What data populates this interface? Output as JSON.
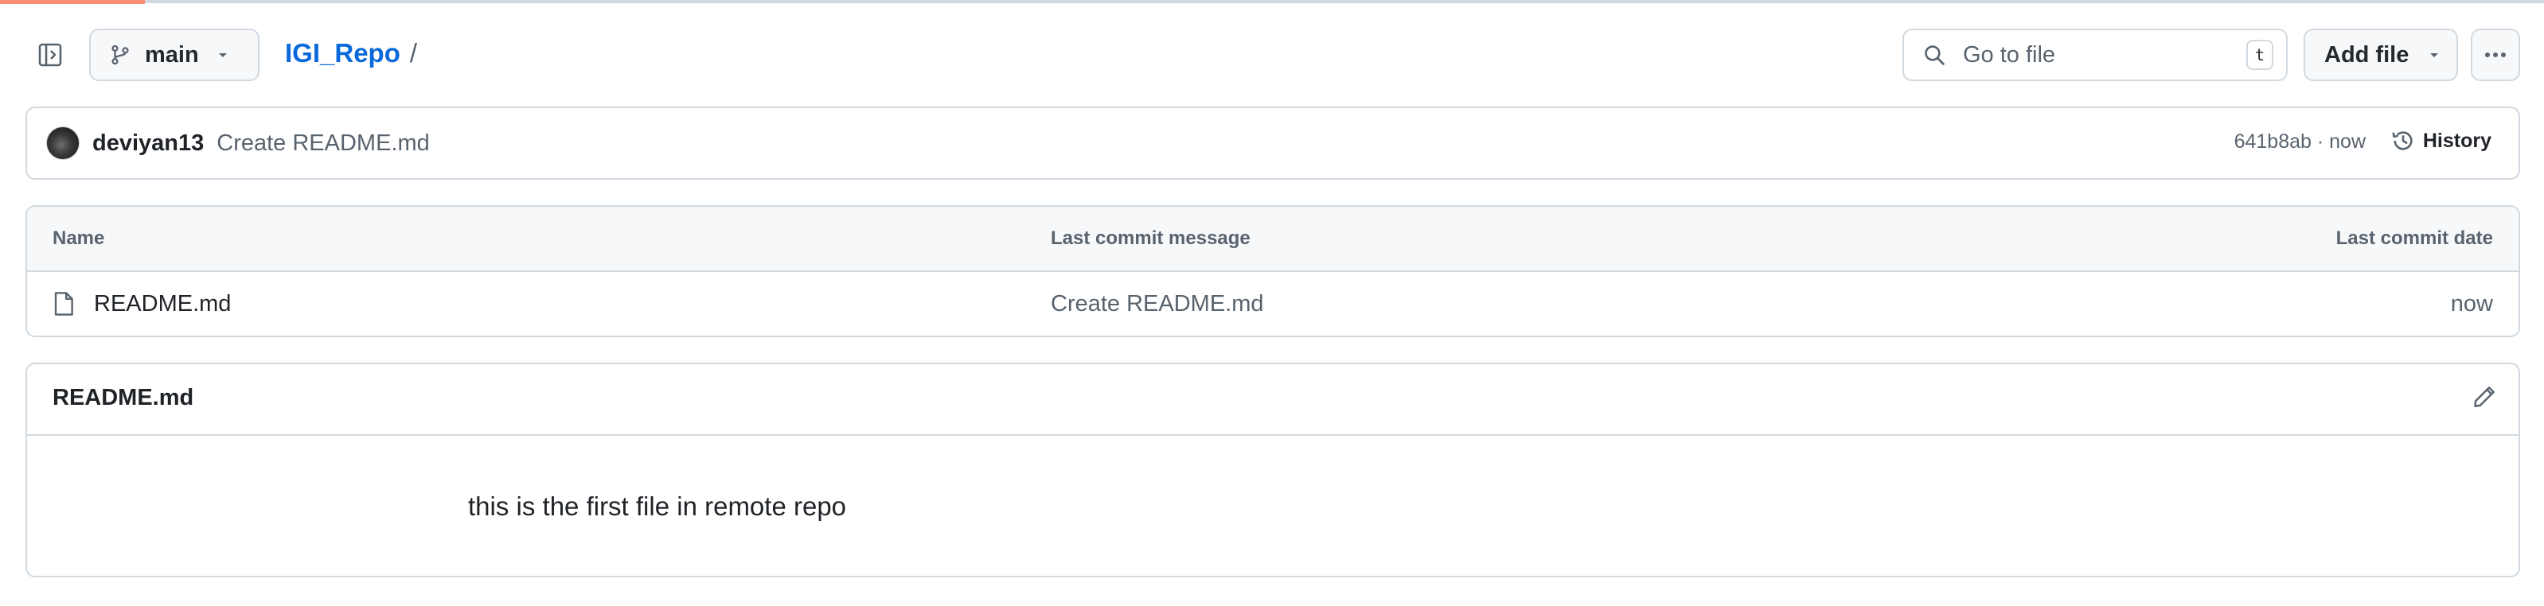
{
  "toolbar": {
    "branch_label": "main",
    "repo_name": "IGI_Repo",
    "separator": "/",
    "search_placeholder": "Go to file",
    "search_shortcut": "t",
    "add_file_label": "Add file",
    "icons": [
      "sidebar-expand-icon",
      "git-branch-icon",
      "chevron-down-icon",
      "search-icon",
      "kebab-horizontal-icon"
    ]
  },
  "commit": {
    "author": "deviyan13",
    "message": "Create README.md",
    "meta": "641b8ab · now",
    "history_label": "History"
  },
  "table": {
    "headers": {
      "name": "Name",
      "message": "Last commit message",
      "date": "Last commit date"
    },
    "rows": [
      {
        "name": "README.md",
        "message": "Create README.md",
        "date": "now",
        "icon": "file-icon"
      }
    ]
  },
  "readme": {
    "title": "README.md",
    "body": "this is the first file in remote repo"
  },
  "colors": {
    "accent_link": "#0969da",
    "border": "#d1d9e0",
    "tab_underline": "#fd8c73",
    "muted_text": "#59636e"
  }
}
